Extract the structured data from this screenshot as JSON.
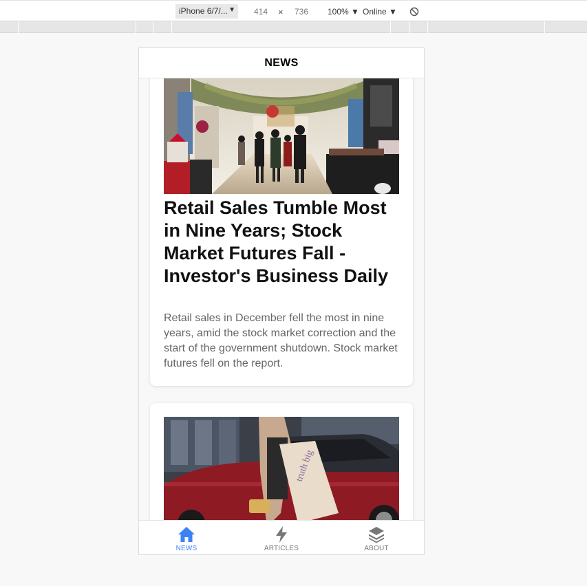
{
  "devtools": {
    "device": "iPhone 6/7/...",
    "width": "414",
    "times": "×",
    "height": "736",
    "zoom": "100%",
    "network": "Online",
    "rotate_icon": "rotate-icon"
  },
  "app": {
    "header_title": "NEWS",
    "articles": [
      {
        "title": "Retail Sales Tumble Most in Nine Years; Stock Market Futures Fall - Investor's Business Daily",
        "description": "Retail sales in December fell the most in nine years, amid the stock market correction and the start of the government shutdown. Stock market futures fell on the report.",
        "image": "department-store-photo"
      },
      {
        "image": "shopper-with-bag-photo"
      }
    ],
    "tabs": [
      {
        "label": "NEWS",
        "icon": "home-icon",
        "active": true
      },
      {
        "label": "ARTICLES",
        "icon": "lightning-icon",
        "active": false
      },
      {
        "label": "ABOUT",
        "icon": "layers-icon",
        "active": false
      }
    ]
  },
  "colors": {
    "accent": "#3b82f6",
    "inactive": "#777777"
  }
}
